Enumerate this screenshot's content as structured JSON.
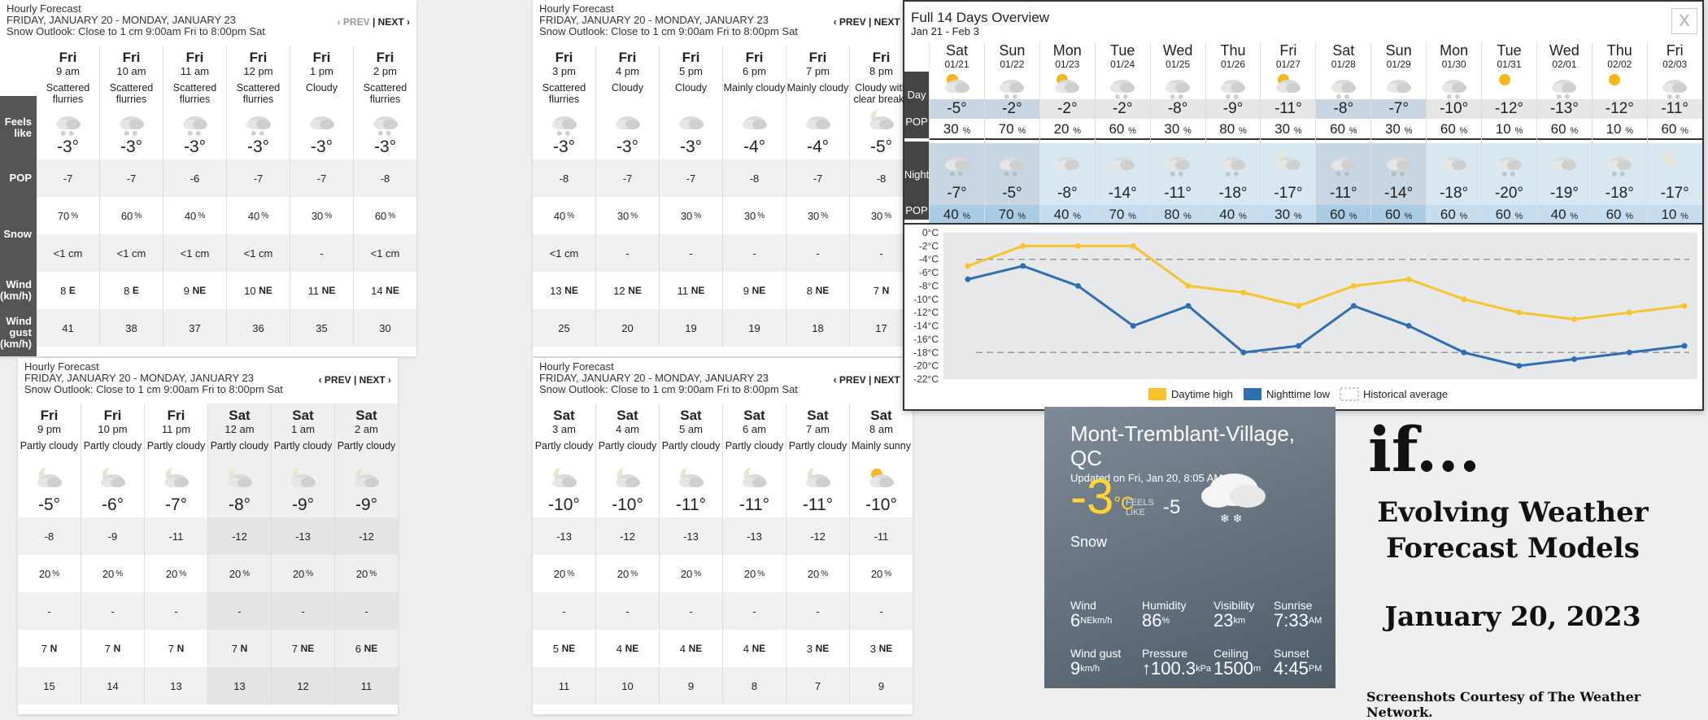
{
  "hourly_common": {
    "title": "Hourly Forecast",
    "dates": "FRIDAY, JANUARY 20 - MONDAY, JANUARY 23",
    "outlook": "Snow Outlook: Close to 1 cm 9:00am Fri to 8:00pm Sat",
    "prev": "‹ PREV",
    "sep": "|",
    "next": "NEXT ›"
  },
  "row_labels": {
    "feels": "Feels like",
    "pop": "POP",
    "snow": "Snow",
    "wind": "Wind (km/h)",
    "gust": "Wind gust (km/h)"
  },
  "panels": [
    {
      "hours": [
        {
          "day": "Fri",
          "time": "9 am",
          "cond": "Scattered flurries",
          "icon": "flurries-icon",
          "temp": "-3°",
          "feels": "-7",
          "pop": "70",
          "snow": "<1 cm",
          "wind": "8",
          "dir": "E",
          "gust": "41"
        },
        {
          "day": "Fri",
          "time": "10 am",
          "cond": "Scattered flurries",
          "icon": "flurries-icon",
          "temp": "-3°",
          "feels": "-7",
          "pop": "60",
          "snow": "<1 cm",
          "wind": "8",
          "dir": "E",
          "gust": "38"
        },
        {
          "day": "Fri",
          "time": "11 am",
          "cond": "Scattered flurries",
          "icon": "flurries-icon",
          "temp": "-3°",
          "feels": "-6",
          "pop": "40",
          "snow": "<1 cm",
          "wind": "9",
          "dir": "NE",
          "gust": "37"
        },
        {
          "day": "Fri",
          "time": "12 pm",
          "cond": "Scattered flurries",
          "icon": "flurries-icon",
          "temp": "-3°",
          "feels": "-7",
          "pop": "40",
          "snow": "<1 cm",
          "wind": "10",
          "dir": "NE",
          "gust": "36"
        },
        {
          "day": "Fri",
          "time": "1 pm",
          "cond": "Cloudy",
          "icon": "cloud-icon",
          "temp": "-3°",
          "feels": "-7",
          "pop": "30",
          "snow": "-",
          "wind": "11",
          "dir": "NE",
          "gust": "35"
        },
        {
          "day": "Fri",
          "time": "2 pm",
          "cond": "Scattered flurries",
          "icon": "flurries-icon",
          "temp": "-3°",
          "feels": "-8",
          "pop": "60",
          "snow": "<1 cm",
          "wind": "14",
          "dir": "NE",
          "gust": "30"
        }
      ]
    },
    {
      "hours": [
        {
          "day": "Fri",
          "time": "3 pm",
          "cond": "Scattered flurries",
          "icon": "flurries-icon",
          "temp": "-3°",
          "feels": "-8",
          "pop": "40",
          "snow": "<1 cm",
          "wind": "13",
          "dir": "NE",
          "gust": "25"
        },
        {
          "day": "Fri",
          "time": "4 pm",
          "cond": "Cloudy",
          "icon": "cloud-icon",
          "temp": "-3°",
          "feels": "-7",
          "pop": "30",
          "snow": "-",
          "wind": "12",
          "dir": "NE",
          "gust": "20"
        },
        {
          "day": "Fri",
          "time": "5 pm",
          "cond": "Cloudy",
          "icon": "cloud-icon",
          "temp": "-3°",
          "feels": "-7",
          "pop": "30",
          "snow": "-",
          "wind": "11",
          "dir": "NE",
          "gust": "19"
        },
        {
          "day": "Fri",
          "time": "6 pm",
          "cond": "Mainly cloudy",
          "icon": "cloud-icon",
          "temp": "-4°",
          "feels": "-8",
          "pop": "30",
          "snow": "-",
          "wind": "9",
          "dir": "NE",
          "gust": "19"
        },
        {
          "day": "Fri",
          "time": "7 pm",
          "cond": "Mainly cloudy",
          "icon": "cloud-icon",
          "temp": "-4°",
          "feels": "-7",
          "pop": "30",
          "snow": "-",
          "wind": "8",
          "dir": "NE",
          "gust": "18"
        },
        {
          "day": "Fri",
          "time": "8 pm",
          "cond": "Cloudy with clear breaks",
          "icon": "moon-cloud-icon",
          "temp": "-5°",
          "feels": "-8",
          "pop": "30",
          "snow": "-",
          "wind": "7",
          "dir": "N",
          "gust": "17"
        }
      ]
    },
    {
      "hours": [
        {
          "day": "Fri",
          "time": "9 pm",
          "cond": "Partly cloudy",
          "icon": "moon-cloud-icon",
          "temp": "-5°",
          "feels": "-8",
          "pop": "20",
          "snow": "-",
          "wind": "7",
          "dir": "N",
          "gust": "15"
        },
        {
          "day": "Fri",
          "time": "10 pm",
          "cond": "Partly cloudy",
          "icon": "moon-cloud-icon",
          "temp": "-6°",
          "feels": "-9",
          "pop": "20",
          "snow": "-",
          "wind": "7",
          "dir": "N",
          "gust": "14"
        },
        {
          "day": "Fri",
          "time": "11 pm",
          "cond": "Partly cloudy",
          "icon": "moon-cloud-icon",
          "temp": "-7°",
          "feels": "-11",
          "pop": "20",
          "snow": "-",
          "wind": "7",
          "dir": "N",
          "gust": "13"
        },
        {
          "day": "Sat",
          "time": "12 am",
          "cond": "Partly cloudy",
          "icon": "moon-cloud-icon",
          "temp": "-8°",
          "feels": "-12",
          "pop": "20",
          "snow": "-",
          "wind": "7",
          "dir": "N",
          "gust": "13"
        },
        {
          "day": "Sat",
          "time": "1 am",
          "cond": "Partly cloudy",
          "icon": "moon-cloud-icon",
          "temp": "-9°",
          "feels": "-13",
          "pop": "20",
          "snow": "-",
          "wind": "7",
          "dir": "NE",
          "gust": "12"
        },
        {
          "day": "Sat",
          "time": "2 am",
          "cond": "Partly cloudy",
          "icon": "moon-cloud-icon",
          "temp": "-9°",
          "feels": "-12",
          "pop": "20",
          "snow": "-",
          "wind": "6",
          "dir": "NE",
          "gust": "11"
        }
      ]
    },
    {
      "hours": [
        {
          "day": "Sat",
          "time": "3 am",
          "cond": "Partly cloudy",
          "icon": "moon-cloud-icon",
          "temp": "-10°",
          "feels": "-13",
          "pop": "20",
          "snow": "-",
          "wind": "5",
          "dir": "NE",
          "gust": "11"
        },
        {
          "day": "Sat",
          "time": "4 am",
          "cond": "Partly cloudy",
          "icon": "moon-cloud-icon",
          "temp": "-10°",
          "feels": "-12",
          "pop": "20",
          "snow": "-",
          "wind": "4",
          "dir": "NE",
          "gust": "10"
        },
        {
          "day": "Sat",
          "time": "5 am",
          "cond": "Partly cloudy",
          "icon": "moon-cloud-icon",
          "temp": "-11°",
          "feels": "-13",
          "pop": "20",
          "snow": "-",
          "wind": "4",
          "dir": "NE",
          "gust": "9"
        },
        {
          "day": "Sat",
          "time": "6 am",
          "cond": "Partly cloudy",
          "icon": "moon-cloud-icon",
          "temp": "-11°",
          "feels": "-13",
          "pop": "20",
          "snow": "-",
          "wind": "4",
          "dir": "NE",
          "gust": "8"
        },
        {
          "day": "Sat",
          "time": "7 am",
          "cond": "Partly cloudy",
          "icon": "moon-cloud-icon",
          "temp": "-11°",
          "feels": "-12",
          "pop": "20",
          "snow": "-",
          "wind": "3",
          "dir": "NE",
          "gust": "7"
        },
        {
          "day": "Sat",
          "time": "8 am",
          "cond": "Mainly sunny",
          "icon": "sun-cloud-icon",
          "temp": "-10°",
          "feels": "-11",
          "pop": "20",
          "snow": "-",
          "wind": "3",
          "dir": "NE",
          "gust": "9"
        }
      ]
    }
  ],
  "overview": {
    "title": "Full 14 Days Overview",
    "range": "Jan 21 - Feb 3",
    "close": "X",
    "labels": {
      "day": "Day",
      "pop": "POP",
      "night": "Night"
    },
    "days": [
      {
        "d": "Sat",
        "date": "01/21",
        "hi": "-5°",
        "dpop": "30",
        "lo": "-7°",
        "npop": "40",
        "weekend": true
      },
      {
        "d": "Sun",
        "date": "01/22",
        "hi": "-2°",
        "dpop": "70",
        "lo": "-5°",
        "npop": "70",
        "weekend": true
      },
      {
        "d": "Mon",
        "date": "01/23",
        "hi": "-2°",
        "dpop": "20",
        "lo": "-8°",
        "npop": "40"
      },
      {
        "d": "Tue",
        "date": "01/24",
        "hi": "-2°",
        "dpop": "60",
        "lo": "-14°",
        "npop": "70"
      },
      {
        "d": "Wed",
        "date": "01/25",
        "hi": "-8°",
        "dpop": "30",
        "lo": "-11°",
        "npop": "80"
      },
      {
        "d": "Thu",
        "date": "01/26",
        "hi": "-9°",
        "dpop": "80",
        "lo": "-18°",
        "npop": "40"
      },
      {
        "d": "Fri",
        "date": "01/27",
        "hi": "-11°",
        "dpop": "30",
        "lo": "-17°",
        "npop": "30"
      },
      {
        "d": "Sat",
        "date": "01/28",
        "hi": "-8°",
        "dpop": "60",
        "lo": "-11°",
        "npop": "60",
        "weekend": true
      },
      {
        "d": "Sun",
        "date": "01/29",
        "hi": "-7°",
        "dpop": "30",
        "lo": "-14°",
        "npop": "60",
        "weekend": true
      },
      {
        "d": "Mon",
        "date": "01/30",
        "hi": "-10°",
        "dpop": "60",
        "lo": "-18°",
        "npop": "60"
      },
      {
        "d": "Tue",
        "date": "01/31",
        "hi": "-12°",
        "dpop": "10",
        "lo": "-20°",
        "npop": "60"
      },
      {
        "d": "Wed",
        "date": "02/01",
        "hi": "-13°",
        "dpop": "60",
        "lo": "-19°",
        "npop": "40"
      },
      {
        "d": "Thu",
        "date": "02/02",
        "hi": "-12°",
        "dpop": "10",
        "lo": "-18°",
        "npop": "60"
      },
      {
        "d": "Fri",
        "date": "02/03",
        "hi": "-11°",
        "dpop": "60",
        "lo": "-17°",
        "npop": "10"
      }
    ]
  },
  "chart_data": {
    "type": "line",
    "categories": [
      "01/21",
      "01/22",
      "01/23",
      "01/24",
      "01/25",
      "01/26",
      "01/27",
      "01/28",
      "01/29",
      "01/30",
      "01/31",
      "02/01",
      "02/02",
      "02/03"
    ],
    "series": [
      {
        "name": "Daytime high",
        "color": "#f7c52b",
        "values": [
          -5,
          -2,
          -2,
          -2,
          -8,
          -9,
          -11,
          -8,
          -7,
          -10,
          -12,
          -13,
          -12,
          -11
        ]
      },
      {
        "name": "Nighttime low",
        "color": "#2f6eb5",
        "values": [
          -7,
          -5,
          -8,
          -14,
          -11,
          -18,
          -17,
          -11,
          -14,
          -18,
          -20,
          -19,
          -18,
          -17
        ]
      },
      {
        "name": "Historical average",
        "color": "#999999",
        "values": [
          -4,
          -18
        ]
      }
    ],
    "yticks": [
      "0°C",
      "-2°C",
      "-4°C",
      "-6°C",
      "-8°C",
      "-10°C",
      "-12°C",
      "-14°C",
      "-16°C",
      "-18°C",
      "-20°C",
      "-22°C"
    ],
    "ylim": [
      -22,
      0
    ],
    "legend": "bottom"
  },
  "current": {
    "city": "Mont-Tremblant-Village, QC",
    "updated": "Updated on Fri, Jan 20, 8:05 AM",
    "temp": "-3",
    "unit": "°C",
    "feels_label1": "FEELS",
    "feels_label2": "LIKE",
    "feels": "-5",
    "condition": "Snow",
    "wind_label": "Wind",
    "wind": "6",
    "wind_dir": "NE",
    "wind_unit": "km/h",
    "humidity_label": "Humidity",
    "humidity": "86",
    "humidity_unit": "%",
    "visibility_label": "Visibility",
    "visibility": "23",
    "visibility_unit": "km",
    "sunrise_label": "Sunrise",
    "sunrise": "7:33",
    "sunrise_unit": "AM",
    "gust_label": "Wind gust",
    "gust": "9",
    "gust_unit": "km/h",
    "pressure_label": "Pressure",
    "pressure": "↑100.3",
    "pressure_unit": "kPa",
    "ceiling_label": "Ceiling",
    "ceiling": "1500",
    "ceiling_unit": "m",
    "sunset_label": "Sunset",
    "sunset": "4:45",
    "sunset_unit": "PM"
  },
  "caption": {
    "if": "if...",
    "line1": "Evolving Weather",
    "line2": "Forecast Models",
    "date": "January 20, 2023",
    "credit": "Screenshots Courtesy of The Weather Network."
  }
}
